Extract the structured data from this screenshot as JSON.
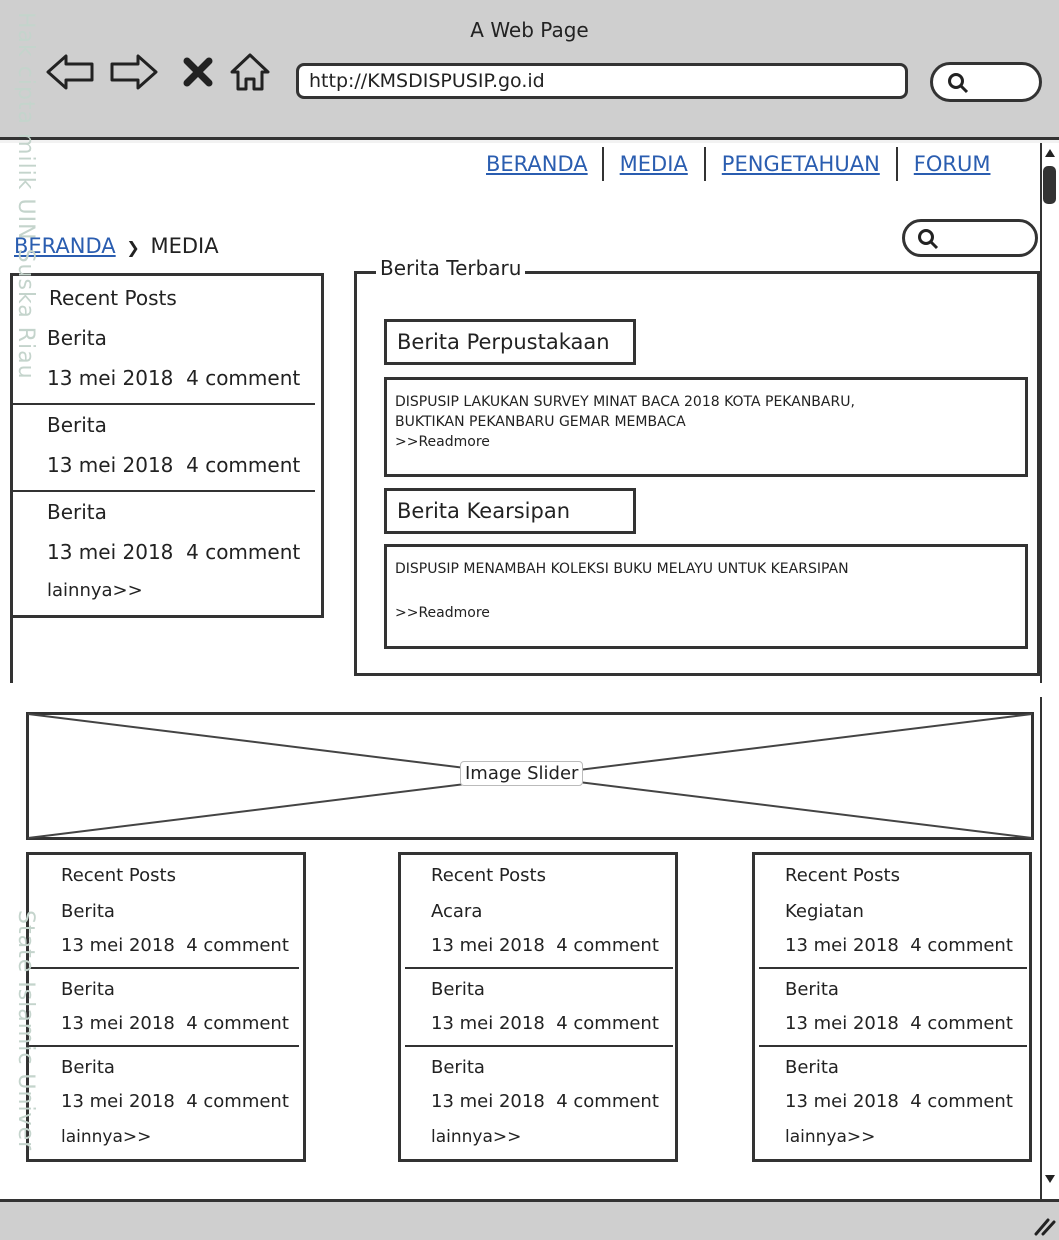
{
  "browser": {
    "title": "A Web Page",
    "url": "http://KMSDISPUSIP.go.id",
    "icons": [
      "back-icon",
      "forward-icon",
      "stop-icon",
      "home-icon",
      "search-icon"
    ]
  },
  "nav": {
    "items": [
      "BERANDA",
      "MEDIA",
      "PENGETAHUAN",
      "FORUM"
    ]
  },
  "breadcrumb": {
    "home": "BERANDA",
    "current": "MEDIA"
  },
  "sidebar": {
    "title": "Recent Posts",
    "posts": [
      {
        "title": "Berita",
        "meta": "13 mei 2018  4 comment"
      },
      {
        "title": "Berita",
        "meta": "13 mei 2018  4 comment"
      },
      {
        "title": "Berita",
        "meta": "13 mei 2018  4 comment"
      }
    ],
    "more": "lainnya>>"
  },
  "news": {
    "legend": "Berita Terbaru",
    "sections": [
      {
        "heading": "Berita Perpustakaan",
        "line1": "DISPUSIP LAKUKAN SURVEY MINAT BACA 2018 KOTA PEKANBARU,",
        "line2": "BUKTIKAN PEKANBARU GEMAR MEMBACA",
        "readmore": ">>Readmore"
      },
      {
        "heading": "Berita Kearsipan",
        "line1": "DISPUSIP MENAMBAH KOLEKSI BUKU MELAYU UNTUK KEARSIPAN",
        "line2": "",
        "readmore": ">>Readmore"
      }
    ]
  },
  "slider": {
    "label": "Image Slider"
  },
  "bottom_panels": [
    {
      "title": "Recent Posts",
      "posts": [
        {
          "title": "Berita",
          "meta": "13 mei 2018  4 comment"
        },
        {
          "title": "Berita",
          "meta": "13 mei 2018  4 comment"
        },
        {
          "title": "Berita",
          "meta": "13 mei 2018  4 comment"
        }
      ],
      "more": "lainnya>>"
    },
    {
      "title": "Recent Posts",
      "posts": [
        {
          "title": "Acara",
          "meta": "13 mei 2018  4 comment"
        },
        {
          "title": "Berita",
          "meta": "13 mei 2018  4 comment"
        },
        {
          "title": "Berita",
          "meta": "13 mei 2018  4 comment"
        }
      ],
      "more": "lainnya>>"
    },
    {
      "title": "Recent Posts",
      "posts": [
        {
          "title": "Kegiatan",
          "meta": "13 mei 2018  4 comment"
        },
        {
          "title": "Berita",
          "meta": "13 mei 2018  4 comment"
        },
        {
          "title": "Berita",
          "meta": "13 mei 2018  4 comment"
        }
      ],
      "more": "lainnya>>"
    }
  ],
  "watermark": {
    "top": "Hak cipta milik UIN Suska Riau",
    "bottom": "State Islamic Univer"
  },
  "colors": {
    "chrome": "#cfcfcf",
    "link": "#2a5db0",
    "ink": "#333333"
  }
}
